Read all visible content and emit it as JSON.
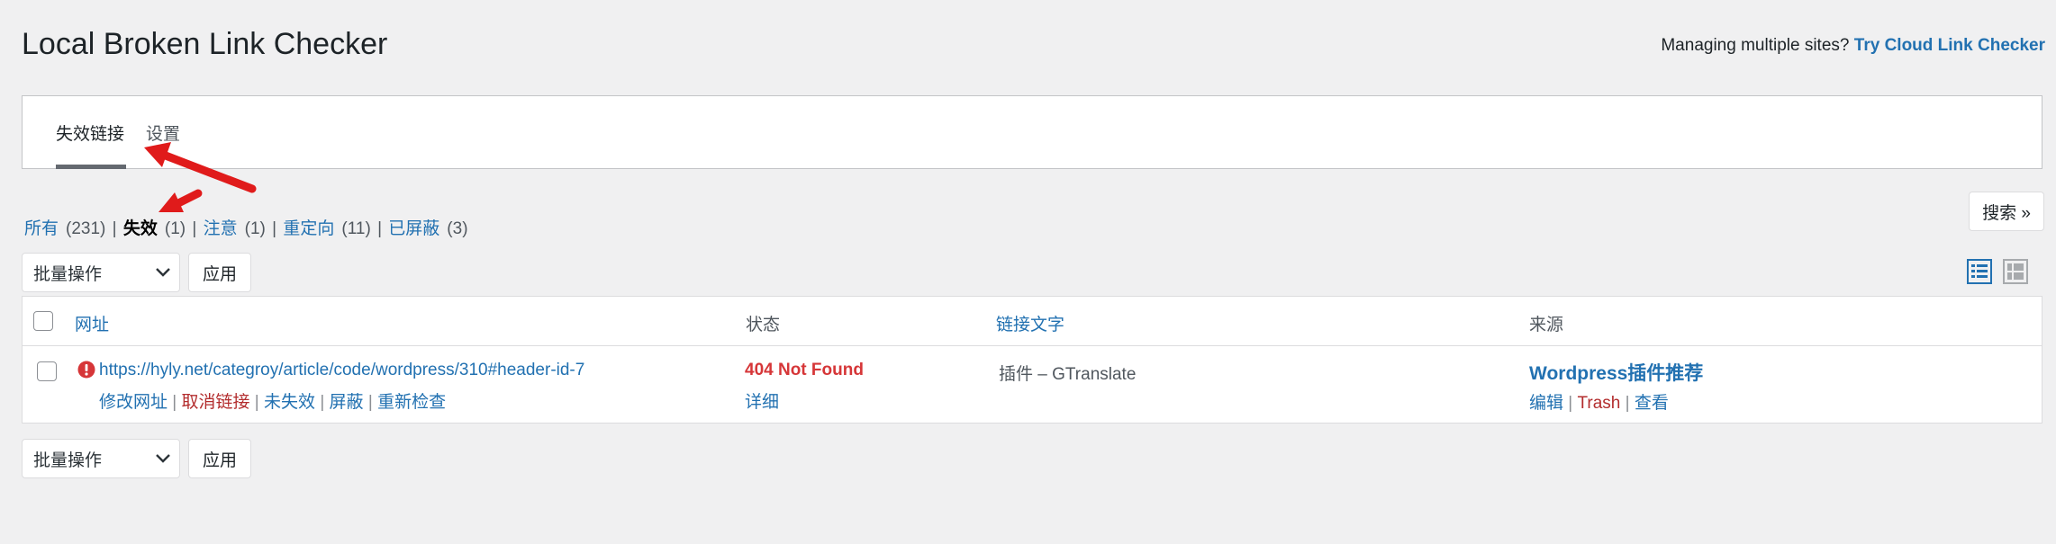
{
  "header": {
    "title": "Local Broken Link Checker",
    "promo_text": "Managing multiple sites?",
    "promo_link": "Try Cloud Link Checker"
  },
  "tabs": [
    {
      "label": "失效链接",
      "active": true
    },
    {
      "label": "设置",
      "active": false
    }
  ],
  "filters": [
    {
      "label": "所有",
      "count": "(231)",
      "current": false
    },
    {
      "label": "失效",
      "count": "(1)",
      "current": true
    },
    {
      "label": "注意",
      "count": "(1)",
      "current": false
    },
    {
      "label": "重定向",
      "count": "(11)",
      "current": false
    },
    {
      "label": "已屏蔽",
      "count": "(3)",
      "current": false
    }
  ],
  "search_button": "搜索 »",
  "bulk": {
    "select_label": "批量操作",
    "apply_label": "应用"
  },
  "table": {
    "columns": [
      "网址",
      "状态",
      "链接文字",
      "来源"
    ],
    "rows": [
      {
        "url": "https://hyly.net/categroy/article/code/wordpress/310#header-id-7",
        "url_actions": [
          "修改网址",
          "取消链接",
          "未失效",
          "屏蔽",
          "重新检查"
        ],
        "status": "404 Not Found",
        "status_detail": "详细",
        "link_text": "插件 – GTranslate",
        "source_title": "Wordpress插件推荐",
        "source_actions": [
          "编辑",
          "Trash",
          "查看"
        ]
      }
    ]
  },
  "colors": {
    "link": "#2271b1",
    "error": "#d63638",
    "delete": "#b32d2e",
    "annotation_arrow": "#e01b1b"
  },
  "icons": {
    "error": "exclamation-circle-icon",
    "dropdown": "chevron-down-icon",
    "view_list": "list-view-icon",
    "view_excerpt": "excerpt-view-icon"
  }
}
